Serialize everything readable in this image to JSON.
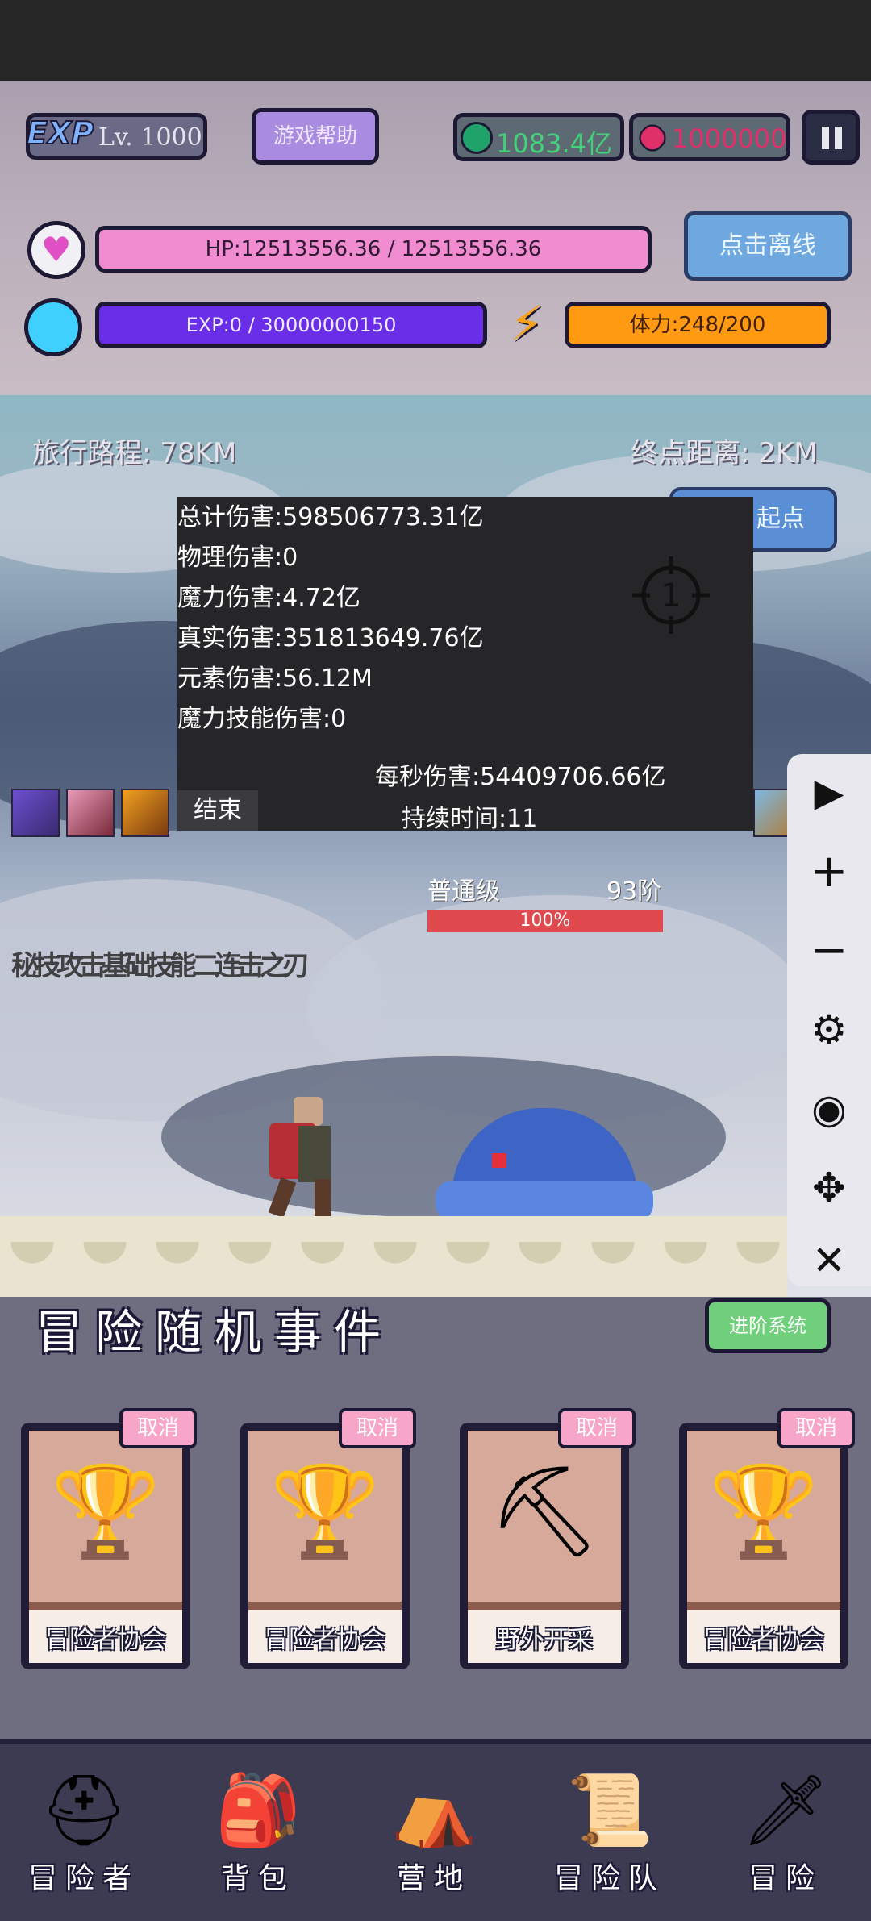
{
  "hud": {
    "exp_logo": "EXP",
    "level": "Lv. 1000",
    "help_button": "游戏帮助",
    "currency_green": "1083.4亿",
    "currency_red": "1000000",
    "hp_text": "HP:12513556.36 / 12513556.36",
    "exp_text": "EXP:0 / 30000000150",
    "stamina_text": "体力:248/200",
    "offline_button": "点击离线"
  },
  "scene": {
    "travel_distance": "旅行路程: 78KM",
    "end_distance": "终点距离: 2KM",
    "start_button": "起点",
    "enemy_rank_left": "普通级",
    "enemy_rank_right": "93阶",
    "enemy_hp_percent": "100%",
    "enemy_hp_fraction": 1.0,
    "skill_float_text": "秘技攻击基础技能二连击之刃"
  },
  "damage_panel": {
    "total": "总计伤害:598506773.31亿",
    "physical": "物理伤害:0",
    "magic": "魔力伤害:4.72亿",
    "true_damage": "真实伤害:351813649.76亿",
    "elemental": "元素伤害:56.12M",
    "magic_skill": "魔力技能伤害:0",
    "dps": "每秒伤害:54409706.66亿",
    "duration": "持续时间:11",
    "target_number": "1",
    "end_button": "结束"
  },
  "sidebar": {
    "play_icon": "▶",
    "plus_icon": "+",
    "minus_icon": "−",
    "gear_icon": "⚙",
    "eye_icon": "◉",
    "move_icon": "✥",
    "close_icon": "✕"
  },
  "events": {
    "title": "冒险随机事件",
    "advance_button": "进阶系统",
    "cards": [
      {
        "label": "冒险者协会",
        "cancel": "取消",
        "icon": "🏆"
      },
      {
        "label": "冒险者协会",
        "cancel": "取消",
        "icon": "🏆"
      },
      {
        "label": "野外开采",
        "cancel": "取消",
        "icon": "⛏"
      },
      {
        "label": "冒险者协会",
        "cancel": "取消",
        "icon": "🏆"
      }
    ]
  },
  "nav": {
    "items": [
      {
        "label": "冒险者",
        "icon": "⛑"
      },
      {
        "label": "背包",
        "icon": "🎒"
      },
      {
        "label": "营地",
        "icon": "⛺"
      },
      {
        "label": "冒险队",
        "icon": "📜"
      },
      {
        "label": "冒险",
        "icon": "🗡"
      }
    ]
  },
  "colors": {
    "hp": "#f28cd0",
    "exp": "#6a2ee8",
    "stamina": "#ff9a12",
    "outline": "#1d1833"
  }
}
